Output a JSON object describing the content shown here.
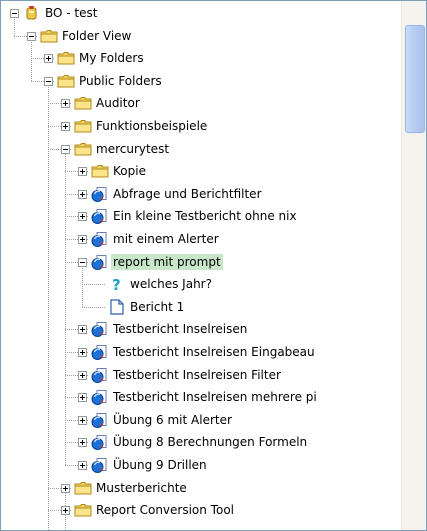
{
  "tree": {
    "nodes": [
      {
        "label": "BO - test",
        "icon": "repository-icon"
      },
      {
        "label": "Folder View",
        "icon": "folder-icon"
      },
      {
        "label": "My Folders",
        "icon": "folder-icon"
      },
      {
        "label": "Public Folders",
        "icon": "folder-icon"
      },
      {
        "label": "Auditor",
        "icon": "folder-icon"
      },
      {
        "label": "Funktionsbeispiele",
        "icon": "folder-icon"
      },
      {
        "label": "mercurytest",
        "icon": "folder-icon"
      },
      {
        "label": "Kopie",
        "icon": "folder-icon"
      },
      {
        "label": "Abfrage und Berichtfilter",
        "icon": "report-icon"
      },
      {
        "label": "Ein kleine Testbericht ohne nix",
        "icon": "report-icon"
      },
      {
        "label": "mit einem Alerter",
        "icon": "report-icon"
      },
      {
        "label": "report mit prompt",
        "icon": "report-icon"
      },
      {
        "label": "welches Jahr?",
        "icon": "prompt-icon"
      },
      {
        "label": "Bericht 1",
        "icon": "document-icon"
      },
      {
        "label": "Testbericht Inselreisen",
        "icon": "report-icon"
      },
      {
        "label": "Testbericht Inselreisen Eingabeau",
        "icon": "report-icon"
      },
      {
        "label": "Testbericht Inselreisen Filter",
        "icon": "report-icon"
      },
      {
        "label": "Testbericht Inselreisen mehrere pi",
        "icon": "report-icon"
      },
      {
        "label": "Übung 6 mit Alerter",
        "icon": "report-icon"
      },
      {
        "label": "Übung 8 Berechnungen Formeln",
        "icon": "report-icon"
      },
      {
        "label": "Übung 9 Drillen",
        "icon": "report-icon"
      },
      {
        "label": "Musterberichte",
        "icon": "folder-icon"
      },
      {
        "label": "Report Conversion Tool",
        "icon": "folder-icon"
      }
    ]
  }
}
